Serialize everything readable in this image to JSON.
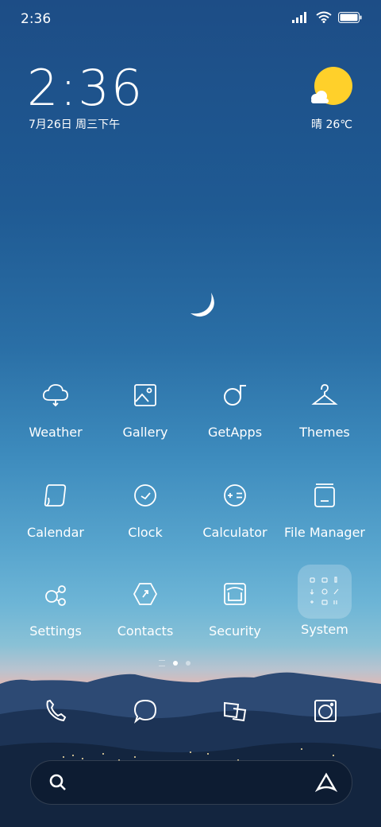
{
  "status": {
    "time": "2:36",
    "icons": [
      "signal-icon",
      "wifi-icon",
      "battery-icon"
    ]
  },
  "clock_widget": {
    "time": "2:36",
    "date": "7月26日 周三下午"
  },
  "weather_widget": {
    "text": "晴 26℃",
    "icon": "sun-cloud-icon"
  },
  "apps": [
    {
      "label": "Weather",
      "icon": "weather-icon"
    },
    {
      "label": "Gallery",
      "icon": "gallery-icon"
    },
    {
      "label": "GetApps",
      "icon": "getapps-icon"
    },
    {
      "label": "Themes",
      "icon": "themes-icon"
    },
    {
      "label": "Calendar",
      "icon": "calendar-icon"
    },
    {
      "label": "Clock",
      "icon": "clock-icon"
    },
    {
      "label": "Calculator",
      "icon": "calculator-icon"
    },
    {
      "label": "File Manager",
      "icon": "file-manager-icon"
    },
    {
      "label": "Settings",
      "icon": "settings-icon"
    },
    {
      "label": "Contacts",
      "icon": "contacts-icon"
    },
    {
      "label": "Security",
      "icon": "security-icon"
    },
    {
      "label": "System",
      "icon": "folder-icon"
    }
  ],
  "page_indicator": {
    "total": 2,
    "current": 1
  },
  "dock": [
    "phone-icon",
    "messages-icon",
    "browser-icon",
    "camera-icon"
  ],
  "search": {
    "left_icon": "search-icon",
    "right_icon": "assistant-icon"
  }
}
